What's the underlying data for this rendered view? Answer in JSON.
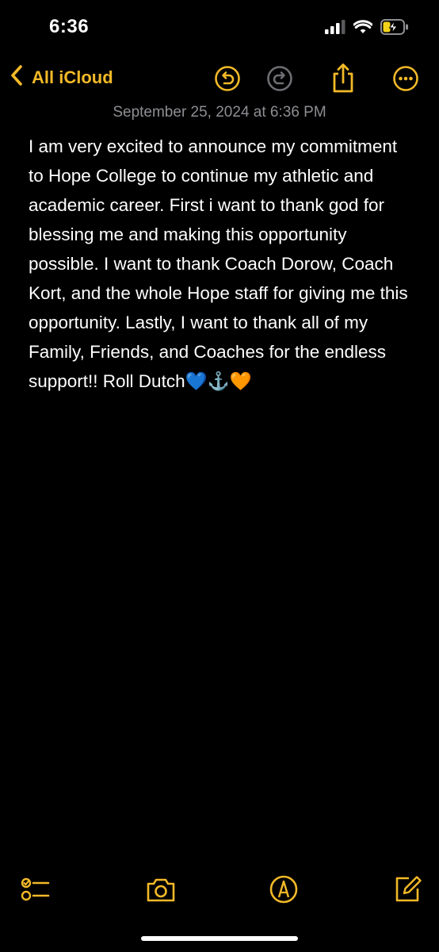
{
  "status_bar": {
    "time": "6:36",
    "icons": [
      "cellular-signal-icon",
      "wifi-icon",
      "battery-charging-icon"
    ]
  },
  "nav": {
    "back_label": "All iCloud",
    "icons": [
      "undo-icon",
      "redo-icon",
      "share-icon",
      "more-icon"
    ]
  },
  "note": {
    "date": "September 25, 2024 at 6:36 PM",
    "body": "I am very excited to announce my commitment to Hope College to continue my athletic and academic career. First i want to thank god for blessing me and making this opportunity possible. I want to thank Coach Dorow, Coach Kort, and the whole Hope staff for giving me this opportunity. Lastly, I want to thank all of my Family, Friends, and Coaches for the endless support!! Roll Dutch💙⚓️🧡"
  },
  "toolbar": {
    "icons": [
      "checklist-icon",
      "camera-icon",
      "markup-icon",
      "compose-icon"
    ]
  },
  "colors": {
    "accent": "#f2b928",
    "background": "#000000",
    "text": "#ffffff",
    "secondary_text": "#8e8e93",
    "disabled": "#6e6e73"
  }
}
